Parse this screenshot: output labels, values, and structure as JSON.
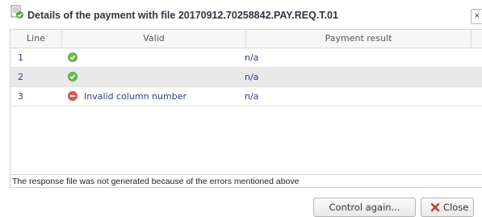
{
  "dialog": {
    "title": "Details of the payment with file 20170912.70258842.PAY.REQ.T.01",
    "close_glyph": "×"
  },
  "table": {
    "columns": [
      "Line",
      "Valid",
      "Payment result"
    ],
    "rows": [
      {
        "line": "1",
        "valid_status": "ok",
        "valid_text": "",
        "payment_result": "n/a"
      },
      {
        "line": "2",
        "valid_status": "ok",
        "valid_text": "",
        "payment_result": "n/a"
      },
      {
        "line": "3",
        "valid_status": "error",
        "valid_text": "Invalid column number",
        "payment_result": "n/a"
      }
    ]
  },
  "message": "The response file was not generated because of the errors mentioned above",
  "buttons": {
    "control_again": "Control again...",
    "close": "Close"
  },
  "colors": {
    "ok_icon": "#6dbb4a",
    "error_icon": "#e0584a",
    "link_text": "#2c3e8c",
    "alt_row": "#e8e8e8"
  },
  "icons": {
    "title": "document-check-icon",
    "ok": "check-circle-icon",
    "error": "minus-circle-icon",
    "close_button": "red-x-icon"
  }
}
